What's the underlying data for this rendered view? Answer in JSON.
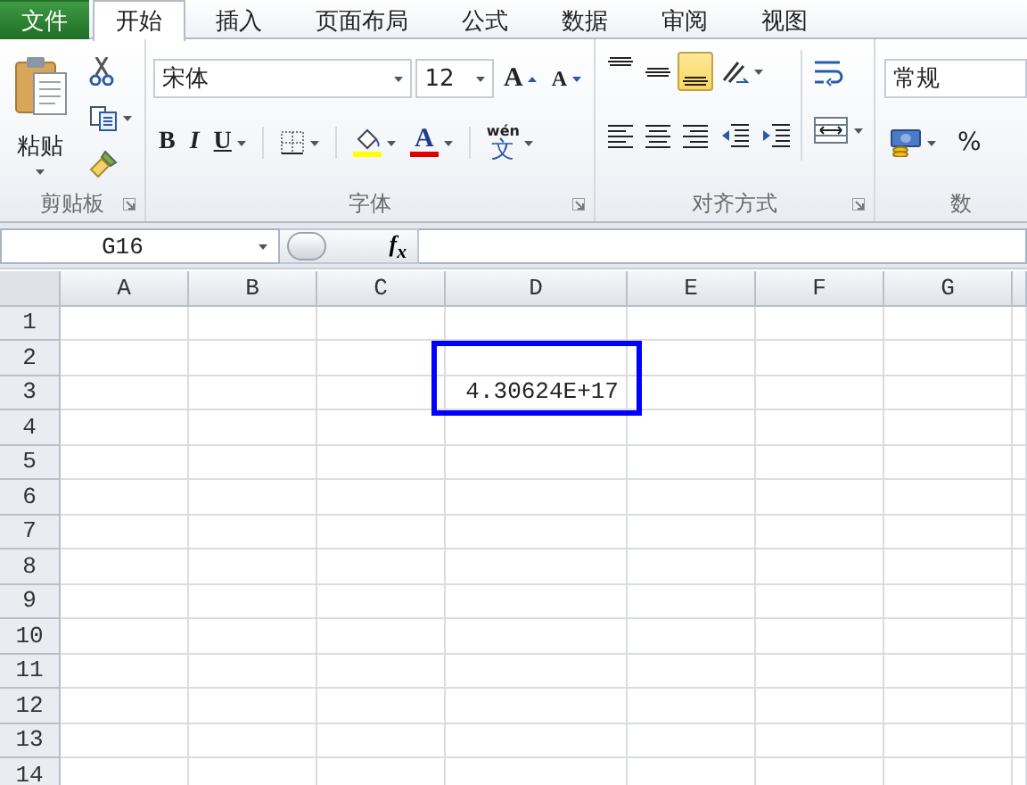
{
  "tabs": [
    {
      "label": "文件",
      "kind": "file",
      "selected": false
    },
    {
      "label": "开始",
      "kind": "tab",
      "selected": true
    },
    {
      "label": "插入",
      "kind": "tab",
      "selected": false
    },
    {
      "label": "页面布局",
      "kind": "tab",
      "selected": false
    },
    {
      "label": "公式",
      "kind": "tab",
      "selected": false
    },
    {
      "label": "数据",
      "kind": "tab",
      "selected": false
    },
    {
      "label": "审阅",
      "kind": "tab",
      "selected": false
    },
    {
      "label": "视图",
      "kind": "tab",
      "selected": false
    }
  ],
  "ribbon": {
    "clipboard": {
      "paste_label": "粘贴",
      "group_label": "剪贴板"
    },
    "font": {
      "font_name": "宋体",
      "font_size": "12",
      "grow_label": "A",
      "shrink_label": "A",
      "bold_label": "B",
      "italic_label": "I",
      "underline_label": "U",
      "font_color_label": "A",
      "phonetic_top": "wén",
      "phonetic_char": "文",
      "group_label": "字体"
    },
    "alignment": {
      "vertical": [
        {
          "kind": "top",
          "selected": false
        },
        {
          "kind": "middle",
          "selected": false
        },
        {
          "kind": "bottom",
          "selected": true
        }
      ],
      "horizontal": [
        {
          "kind": "left",
          "selected": false
        },
        {
          "kind": "center",
          "selected": false
        },
        {
          "kind": "right",
          "selected": false
        }
      ],
      "group_label": "对齐方式"
    },
    "number": {
      "format": "常规",
      "percent_label": "%",
      "group_label": "数"
    }
  },
  "formula_bar": {
    "name_box": "G16",
    "fx_label": "f$_{x}$"
  },
  "sheet": {
    "columns": [
      "A",
      "B",
      "C",
      "D",
      "E",
      "F",
      "G"
    ],
    "rows": [
      {
        "header": "1"
      },
      {
        "header": "2"
      },
      {
        "header": "3",
        "D": "4.30624E+17",
        "highlighted": true
      },
      {
        "header": "4"
      },
      {
        "header": "5"
      },
      {
        "header": "6"
      },
      {
        "header": "7"
      },
      {
        "header": "8"
      },
      {
        "header": "9"
      },
      {
        "header": "10"
      },
      {
        "header": "11"
      },
      {
        "header": "12"
      },
      {
        "header": "13"
      },
      {
        "header": "14"
      }
    ]
  }
}
